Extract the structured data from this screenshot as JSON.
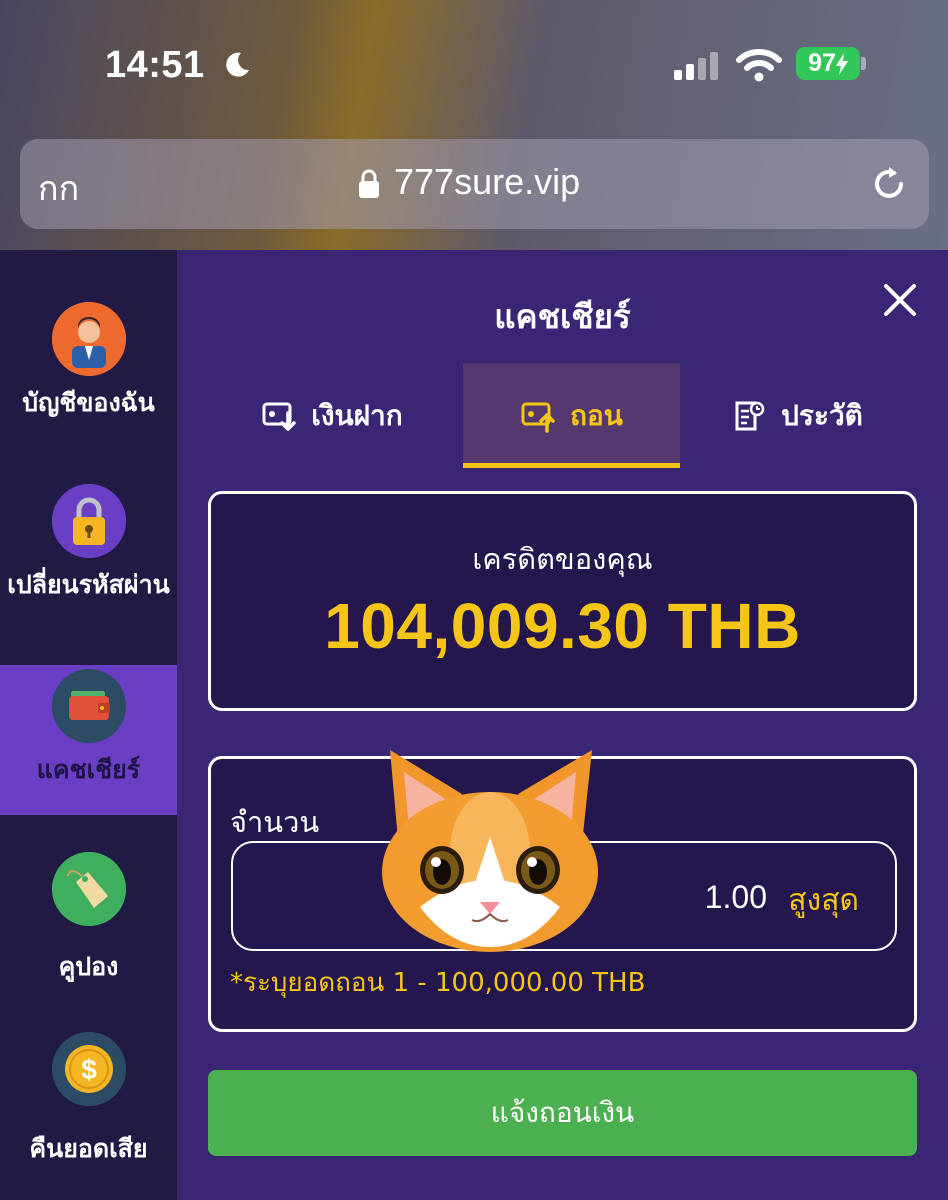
{
  "status_bar": {
    "time": "14:51",
    "battery": "97"
  },
  "browser": {
    "aa_label": "กก",
    "url": "777sure.vip"
  },
  "sidebar": {
    "items": [
      {
        "label": "บัญชีของฉัน",
        "icon": "user-avatar-icon"
      },
      {
        "label": "เปลี่ยนรหัสผ่าน",
        "icon": "padlock-icon"
      },
      {
        "label": "แคชเชียร์",
        "icon": "wallet-icon",
        "active": true
      },
      {
        "label": "คูปอง",
        "icon": "coupon-tag-icon"
      },
      {
        "label": "คืนยอดเสีย",
        "icon": "dollar-coin-icon"
      }
    ]
  },
  "page": {
    "title": "แคชเชียร์"
  },
  "tabs": [
    {
      "label": "เงินฝาก",
      "icon": "deposit-icon"
    },
    {
      "label": "ถอน",
      "icon": "withdraw-icon",
      "active": true
    },
    {
      "label": "ประวัติ",
      "icon": "history-icon"
    }
  ],
  "credit": {
    "label": "เครดิตของคุณ",
    "amount": "104,009.30 THB"
  },
  "withdraw_form": {
    "amount_label": "จำนวน",
    "amount_value": "1.00",
    "max_label": "สูงสุด",
    "hint": "*ระบุยอดถอน 1 - 100,000.00 THB",
    "submit_label": "แจ้งถอนเงิน"
  },
  "colors": {
    "accent": "#f5c517",
    "panel": "#3b2575",
    "sidebar": "#211a45",
    "sidebar_active": "#6a3fc5",
    "submit": "#4caf50"
  }
}
